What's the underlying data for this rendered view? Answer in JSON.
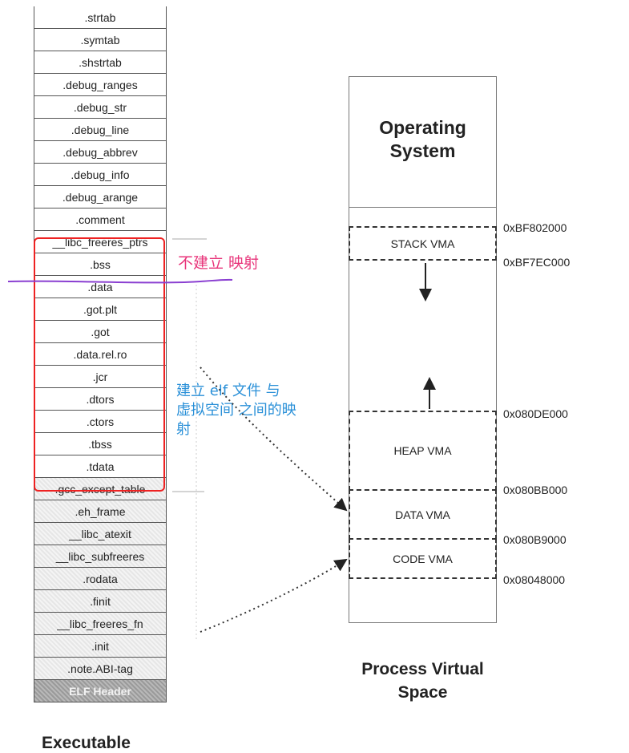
{
  "executable": {
    "title": "Executable",
    "sections": [
      {
        "label": ".strtab",
        "style": "plain"
      },
      {
        "label": ".symtab",
        "style": "plain"
      },
      {
        "label": ".shstrtab",
        "style": "plain"
      },
      {
        "label": ".debug_ranges",
        "style": "plain"
      },
      {
        "label": ".debug_str",
        "style": "plain"
      },
      {
        "label": ".debug_line",
        "style": "plain"
      },
      {
        "label": ".debug_abbrev",
        "style": "plain"
      },
      {
        "label": ".debug_info",
        "style": "plain"
      },
      {
        "label": ".debug_arange",
        "style": "plain"
      },
      {
        "label": ".comment",
        "style": "plain"
      },
      {
        "label": "__libc_freeres_ptrs",
        "style": "plain"
      },
      {
        "label": ".bss",
        "style": "plain"
      },
      {
        "label": ".data",
        "style": "plain"
      },
      {
        "label": ".got.plt",
        "style": "plain"
      },
      {
        "label": ".got",
        "style": "plain"
      },
      {
        "label": ".data.rel.ro",
        "style": "plain"
      },
      {
        "label": ".jcr",
        "style": "plain"
      },
      {
        "label": ".dtors",
        "style": "plain"
      },
      {
        "label": ".ctors",
        "style": "plain"
      },
      {
        "label": ".tbss",
        "style": "plain"
      },
      {
        "label": ".tdata",
        "style": "plain"
      },
      {
        "label": ".gcc_except_table",
        "style": "shade"
      },
      {
        "label": ".eh_frame",
        "style": "shade"
      },
      {
        "label": "__libc_atexit",
        "style": "shade"
      },
      {
        "label": "__libc_subfreeres",
        "style": "shade"
      },
      {
        "label": ".rodata",
        "style": "shade"
      },
      {
        "label": ".finit",
        "style": "shade"
      },
      {
        "label": "__libc_freeres_fn",
        "style": "shade"
      },
      {
        "label": ".init",
        "style": "shade"
      },
      {
        "label": ".note.ABI-tag",
        "style": "shade"
      },
      {
        "label": "ELF Header",
        "style": "dark"
      }
    ]
  },
  "annotations": {
    "no_mapping": "不建立 映射",
    "elf_mapping": "建立 elf 文件 与 虚拟空间 之间的映射"
  },
  "virtual_space": {
    "title_line1": "Process Virtual",
    "title_line2": "Space",
    "os_line1": "Operating",
    "os_line2": "System",
    "stack_vma": "STACK VMA",
    "heap_vma": "HEAP VMA",
    "data_vma": "DATA VMA",
    "code_vma": "CODE VMA",
    "addresses": {
      "stack_top": "0xBF802000",
      "stack_bottom": "0xBF7EC000",
      "heap_top": "0x080DE000",
      "heap_bottom": "0x080BB000",
      "data_bottom": "0x080B9000",
      "code_bottom": "0x08048000"
    }
  },
  "colors": {
    "red_box": "#ee2222",
    "pink_text": "#e8347a",
    "blue_text": "#2a90d8",
    "purple_line": "#8a3fd1"
  }
}
